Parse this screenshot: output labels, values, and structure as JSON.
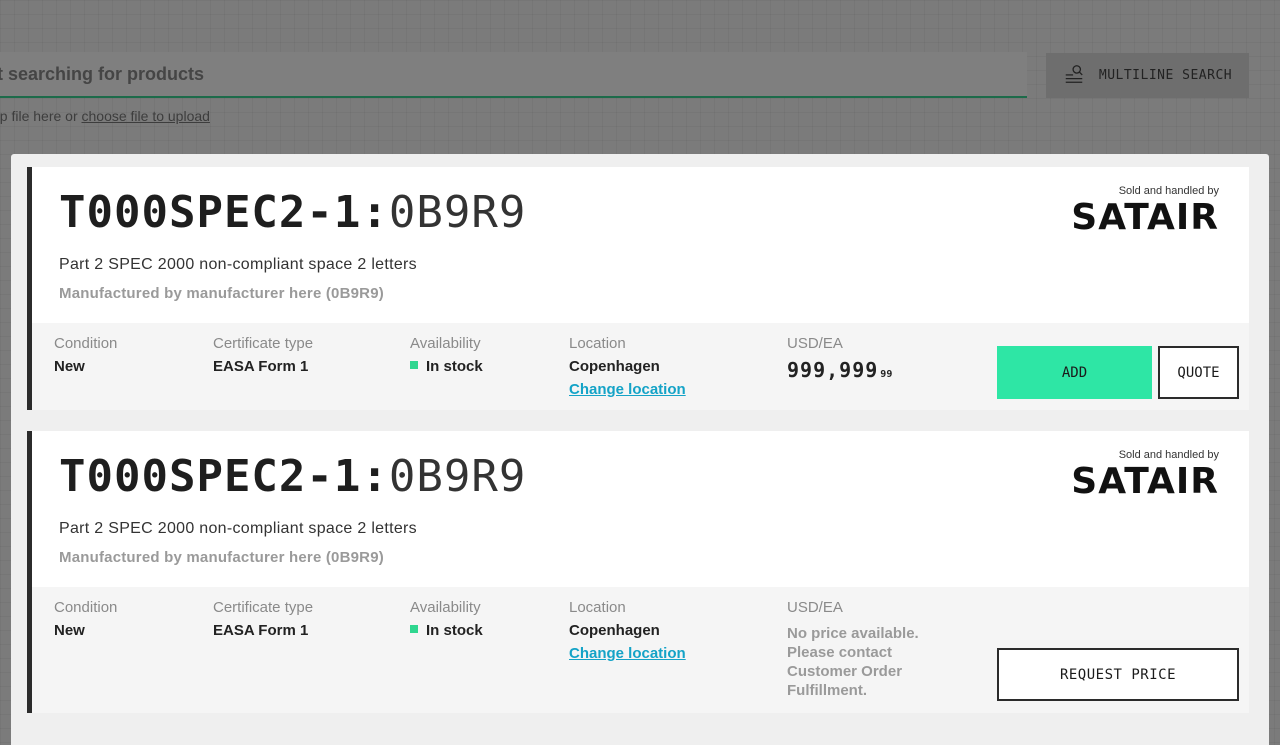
{
  "search": {
    "placeholder": "rt searching for products",
    "upload_prefix": "op file here or ",
    "upload_link": "choose file to upload",
    "multiline_label": "MULTILINE SEARCH"
  },
  "colors": {
    "accent_green": "#2ee6a5",
    "link_blue": "#14a3c7",
    "stock_green": "#2fd68f"
  },
  "labels": {
    "sold_by": "Sold and handled by",
    "seller": "SATAIR",
    "condition": "Condition",
    "certificate": "Certificate type",
    "availability": "Availability",
    "location": "Location",
    "currency": "USD/EA",
    "change_location": "Change location"
  },
  "products": [
    {
      "part_number": "T000SPEC2-1:",
      "mfr_code": "0B9R9",
      "description": "Part 2 SPEC 2000 non-compliant space 2 letters",
      "manufacturer": "Manufactured by manufacturer here (0B9R9)",
      "condition": "New",
      "certificate": "EASA Form 1",
      "availability": "In stock",
      "location": "Copenhagen",
      "price_main": "999,999",
      "price_cents": "99",
      "add_label": "ADD",
      "quote_label": "QUOTE"
    },
    {
      "part_number": "T000SPEC2-1:",
      "mfr_code": "0B9R9",
      "description": "Part 2 SPEC 2000 non-compliant space 2 letters",
      "manufacturer": "Manufactured by manufacturer here (0B9R9)",
      "condition": "New",
      "certificate": "EASA Form 1",
      "availability": "In stock",
      "location": "Copenhagen",
      "no_price_text": "No price available. Please contact Customer Order Fulfillment.",
      "request_label": "REQUEST PRICE"
    }
  ]
}
